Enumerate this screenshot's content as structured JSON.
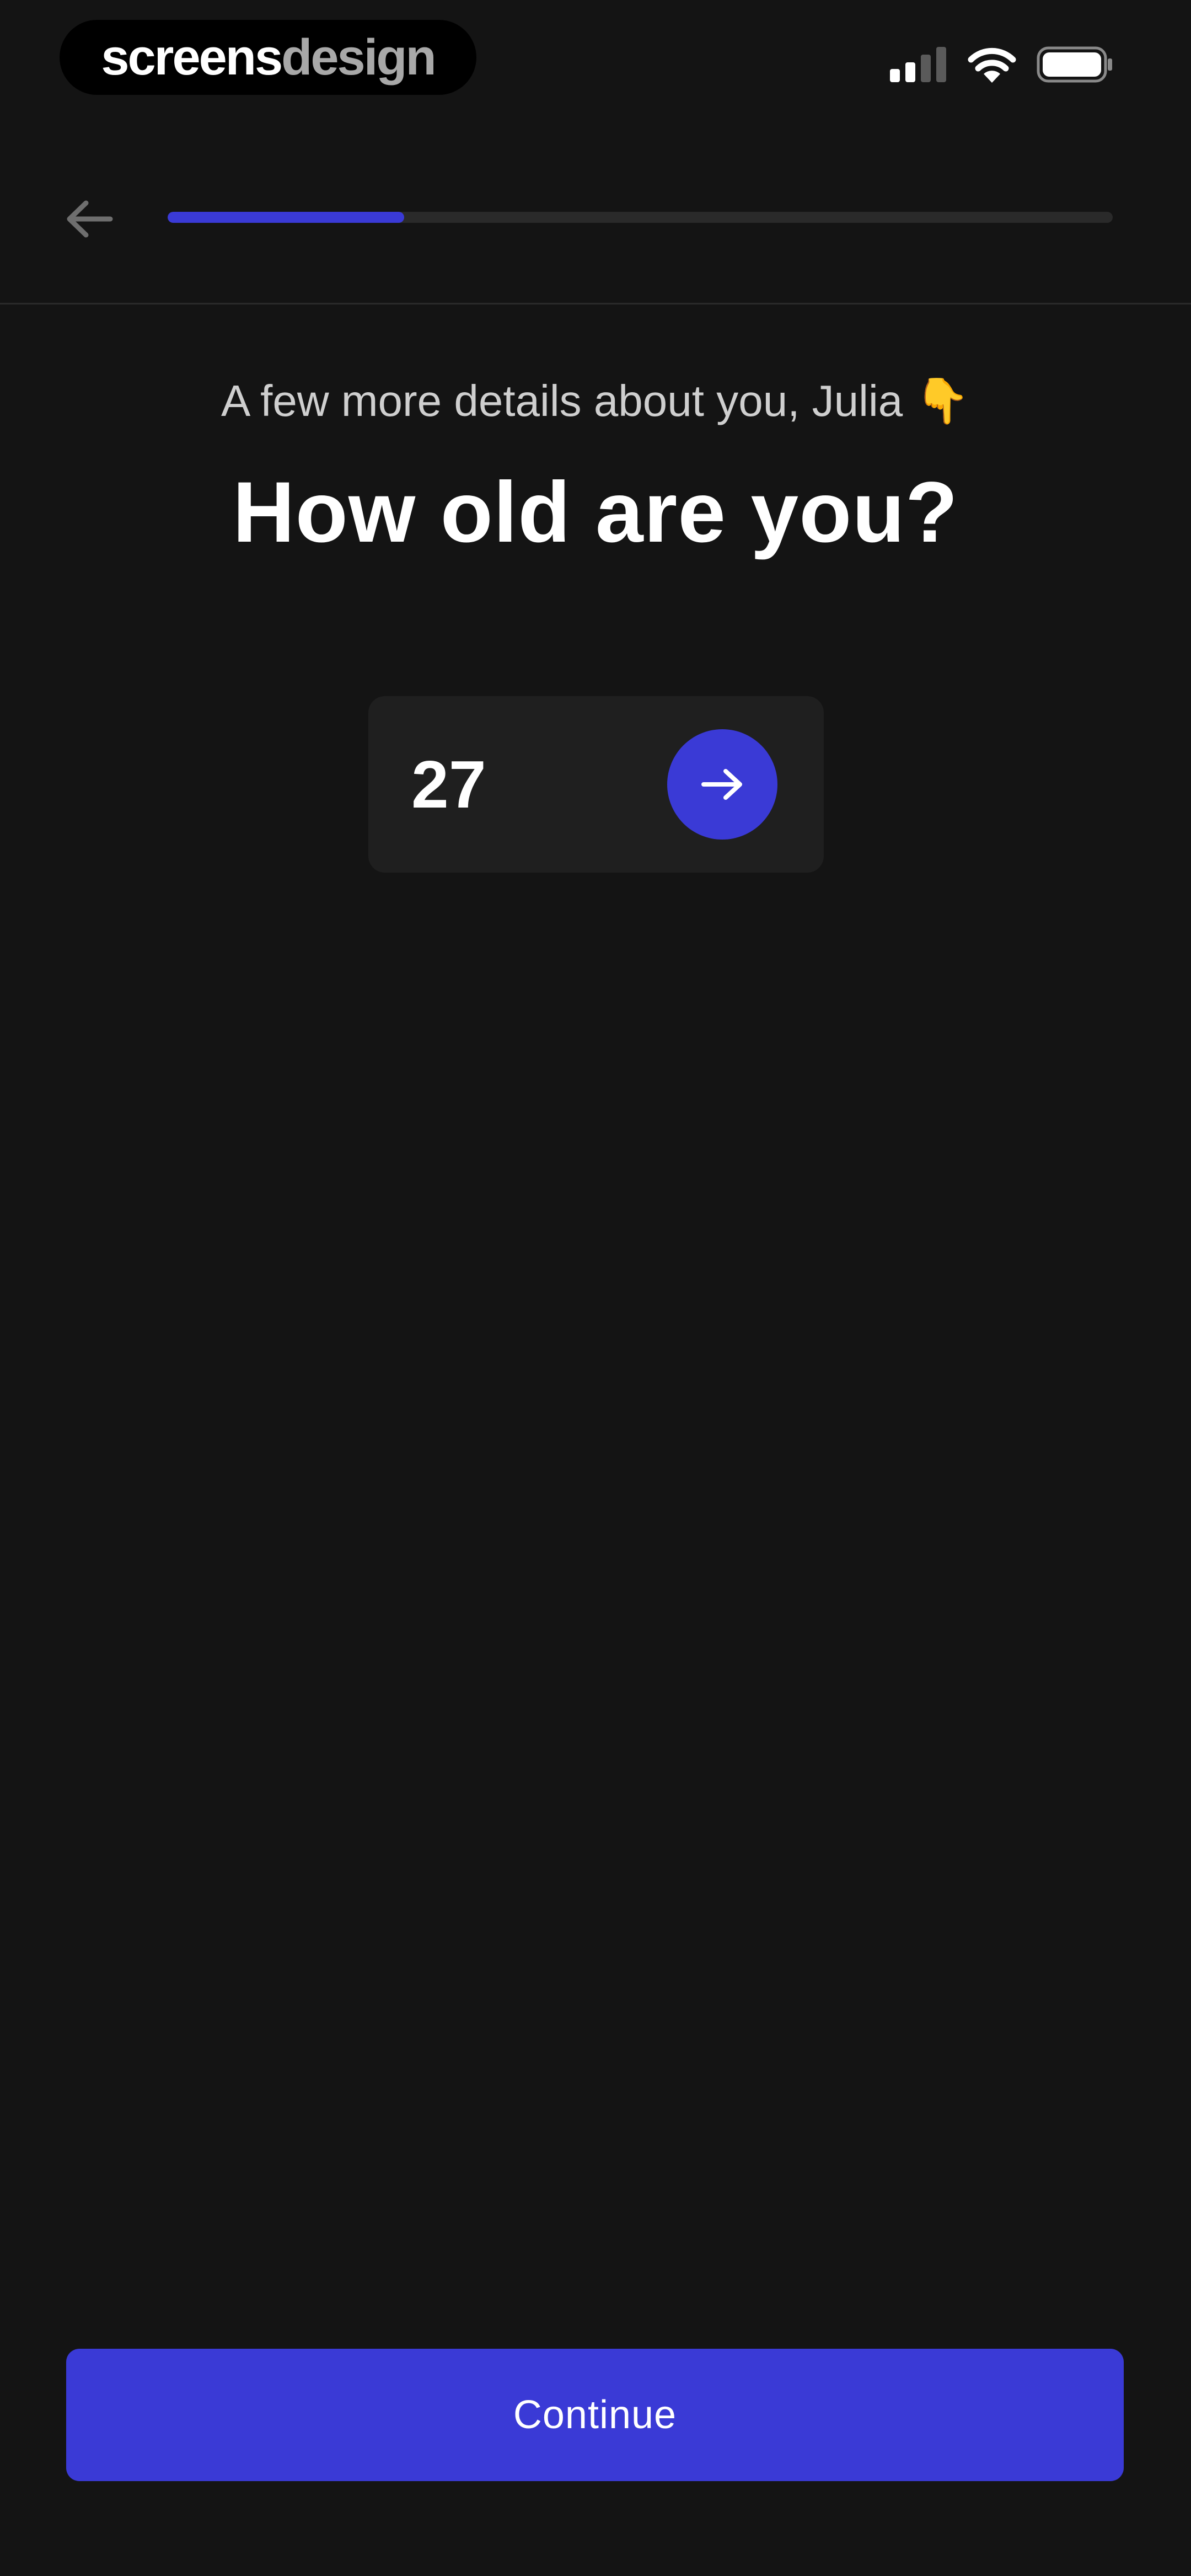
{
  "status_bar": {
    "brand_primary": "screens",
    "brand_secondary": "design",
    "signal_icon": "cellular-signal-icon",
    "wifi_icon": "wifi-icon",
    "battery_icon": "battery-icon"
  },
  "header": {
    "back_icon": "arrow-left-icon",
    "progress_fraction": 0.25
  },
  "content": {
    "subtitle": "A few more details about you, Julia 👇",
    "title": "How old are you?",
    "age_value": "27",
    "submit_icon": "arrow-right-icon"
  },
  "footer": {
    "continue_label": "Continue"
  },
  "colors": {
    "background": "#141414",
    "accent": "#3a3ad6",
    "card": "#1f1f1f",
    "track": "#2a2a2a"
  }
}
